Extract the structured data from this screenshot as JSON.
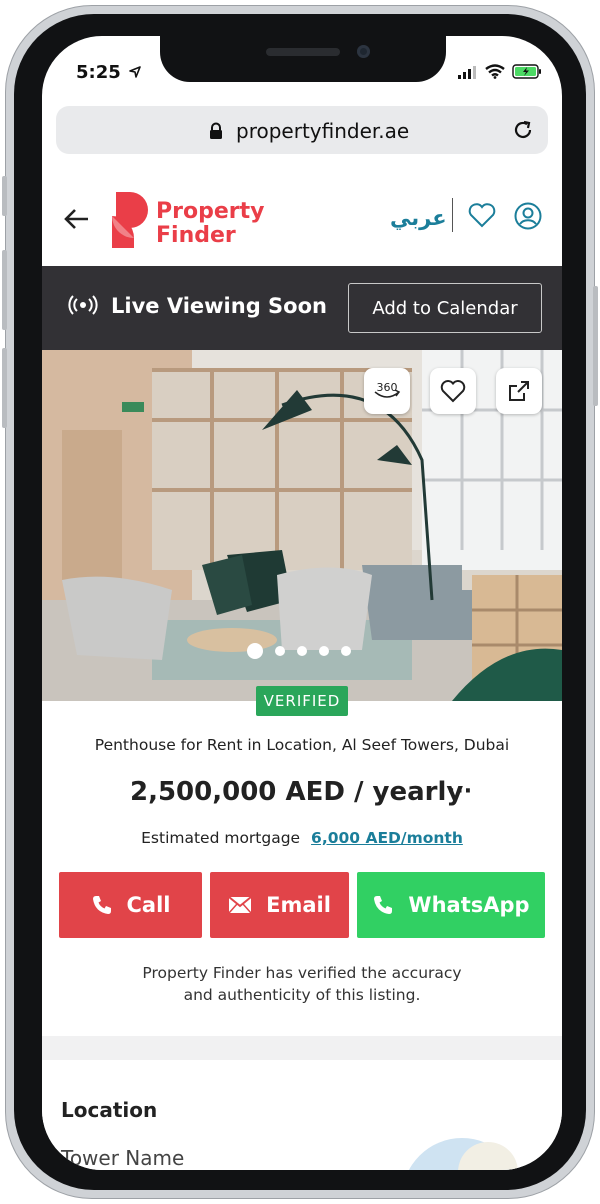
{
  "status_bar": {
    "time": "5:25"
  },
  "browser": {
    "url": "propertyfinder.ae"
  },
  "header": {
    "brand_line1": "Property",
    "brand_line2": "Finder",
    "language_toggle": "عربي"
  },
  "live_bar": {
    "label": "Live Viewing Soon",
    "calendar_button": "Add to Calendar"
  },
  "gallery": {
    "photo_buttons": [
      "360",
      "heart",
      "share"
    ],
    "dots_count": 5,
    "active_dot": 1
  },
  "listing": {
    "badge": "VERIFIED",
    "title": "Penthouse for Rent in Location, Al Seef Towers, Dubai",
    "price": "2,500,000 AED / yearly",
    "more": "···",
    "mortgage_label": "Estimated mortgage",
    "mortgage_value": "6,000 AED/month"
  },
  "actions": {
    "call": "Call",
    "email": "Email",
    "whatsapp": "WhatsApp"
  },
  "verification_note_line1": "Property Finder has verified the accuracy",
  "verification_note_line2": "and authenticity of this listing.",
  "location_section": {
    "title": "Location",
    "first_field": "Tower Name"
  },
  "colors": {
    "brand_red": "#ea3e48",
    "accent_teal": "#1b7e9a",
    "live_bar_bg": "#323135",
    "verified_green": "#2aa65a",
    "whatsapp_green": "#31d063",
    "cta_red": "#e14449"
  }
}
